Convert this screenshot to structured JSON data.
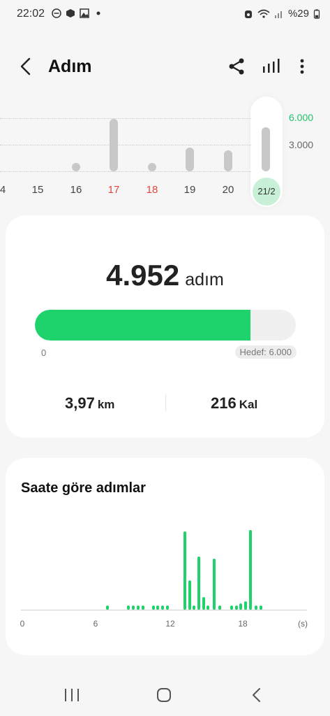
{
  "status_bar": {
    "time": "22:02",
    "battery": "%29",
    "left_icons": [
      "do-not-disturb-icon",
      "box-icon",
      "image-icon",
      "dot-icon"
    ],
    "right_icons": [
      "alarm-icon",
      "wifi-icon",
      "signal-icon"
    ]
  },
  "app_bar": {
    "title": "Adım",
    "icons": [
      "back-icon",
      "share-icon",
      "chart-icon",
      "more-icon"
    ]
  },
  "week_chart": {
    "y_ticks": [
      "6.000",
      "3.000"
    ],
    "days": [
      "4",
      "15",
      "16",
      "17",
      "18",
      "19",
      "20",
      "21/2"
    ],
    "weekend_days": [
      "17",
      "18"
    ],
    "selected_day": "21/2",
    "values": [
      null,
      null,
      600,
      5900,
      600,
      2700,
      2400,
      4952
    ],
    "accent_color": "#1ec36a"
  },
  "summary": {
    "steps": "4.952",
    "steps_unit": "adım",
    "progress_fraction": 0.825,
    "zero_label": "0",
    "goal_label": "Hedef: 6.000",
    "distance": "3,97",
    "distance_unit": "km",
    "calories": "216",
    "calories_unit": "Kal"
  },
  "hourly": {
    "title": "Saate göre adımlar",
    "x_ticks": [
      "0",
      "6",
      "12",
      "18",
      "(s)"
    ],
    "hours": [
      7.3,
      9.1,
      9.5,
      9.9,
      10.3,
      11.2,
      11.6,
      12.0,
      12.4,
      13.9,
      14.3,
      14.7,
      15.1,
      15.5,
      15.9,
      16.4,
      16.9,
      17.9,
      18.3,
      18.7,
      19.1,
      19.5,
      20.0,
      20.4
    ],
    "values": [
      4,
      4,
      4,
      4,
      4,
      4,
      4,
      4,
      4,
      75,
      28,
      4,
      51,
      12,
      4,
      49,
      4,
      4,
      4,
      6,
      8,
      76,
      4,
      4
    ]
  }
}
